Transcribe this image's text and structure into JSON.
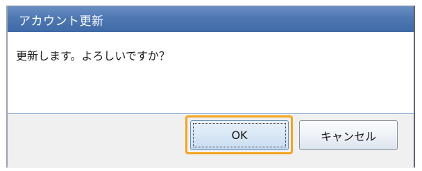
{
  "dialog": {
    "title": "アカウント更新",
    "message": "更新します。よろしいですか？",
    "buttons": {
      "ok_label": "OK",
      "cancel_label": "キャンセル"
    },
    "focused_button": "ok"
  },
  "colors": {
    "title_bar": "#4f78b3",
    "focus_ring": "#f2a51e",
    "button_area": "#f0f0f0"
  }
}
